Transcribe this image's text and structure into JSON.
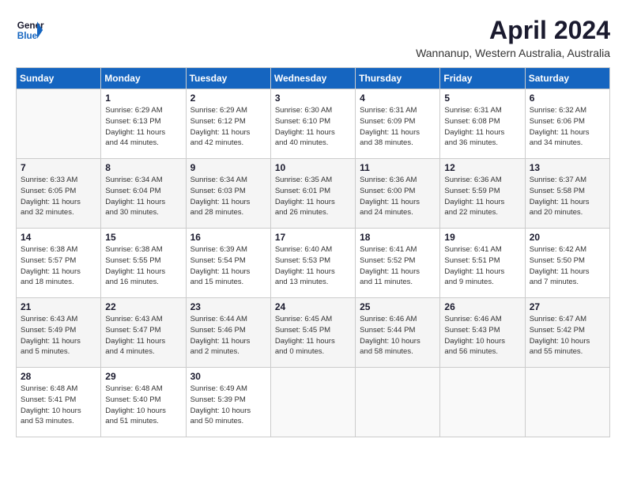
{
  "header": {
    "logo_line1": "General",
    "logo_line2": "Blue",
    "month": "April 2024",
    "location": "Wannanup, Western Australia, Australia"
  },
  "days_of_week": [
    "Sunday",
    "Monday",
    "Tuesday",
    "Wednesday",
    "Thursday",
    "Friday",
    "Saturday"
  ],
  "weeks": [
    [
      {
        "day": "",
        "info": ""
      },
      {
        "day": "1",
        "info": "Sunrise: 6:29 AM\nSunset: 6:13 PM\nDaylight: 11 hours\nand 44 minutes."
      },
      {
        "day": "2",
        "info": "Sunrise: 6:29 AM\nSunset: 6:12 PM\nDaylight: 11 hours\nand 42 minutes."
      },
      {
        "day": "3",
        "info": "Sunrise: 6:30 AM\nSunset: 6:10 PM\nDaylight: 11 hours\nand 40 minutes."
      },
      {
        "day": "4",
        "info": "Sunrise: 6:31 AM\nSunset: 6:09 PM\nDaylight: 11 hours\nand 38 minutes."
      },
      {
        "day": "5",
        "info": "Sunrise: 6:31 AM\nSunset: 6:08 PM\nDaylight: 11 hours\nand 36 minutes."
      },
      {
        "day": "6",
        "info": "Sunrise: 6:32 AM\nSunset: 6:06 PM\nDaylight: 11 hours\nand 34 minutes."
      }
    ],
    [
      {
        "day": "7",
        "info": "Sunrise: 6:33 AM\nSunset: 6:05 PM\nDaylight: 11 hours\nand 32 minutes."
      },
      {
        "day": "8",
        "info": "Sunrise: 6:34 AM\nSunset: 6:04 PM\nDaylight: 11 hours\nand 30 minutes."
      },
      {
        "day": "9",
        "info": "Sunrise: 6:34 AM\nSunset: 6:03 PM\nDaylight: 11 hours\nand 28 minutes."
      },
      {
        "day": "10",
        "info": "Sunrise: 6:35 AM\nSunset: 6:01 PM\nDaylight: 11 hours\nand 26 minutes."
      },
      {
        "day": "11",
        "info": "Sunrise: 6:36 AM\nSunset: 6:00 PM\nDaylight: 11 hours\nand 24 minutes."
      },
      {
        "day": "12",
        "info": "Sunrise: 6:36 AM\nSunset: 5:59 PM\nDaylight: 11 hours\nand 22 minutes."
      },
      {
        "day": "13",
        "info": "Sunrise: 6:37 AM\nSunset: 5:58 PM\nDaylight: 11 hours\nand 20 minutes."
      }
    ],
    [
      {
        "day": "14",
        "info": "Sunrise: 6:38 AM\nSunset: 5:57 PM\nDaylight: 11 hours\nand 18 minutes."
      },
      {
        "day": "15",
        "info": "Sunrise: 6:38 AM\nSunset: 5:55 PM\nDaylight: 11 hours\nand 16 minutes."
      },
      {
        "day": "16",
        "info": "Sunrise: 6:39 AM\nSunset: 5:54 PM\nDaylight: 11 hours\nand 15 minutes."
      },
      {
        "day": "17",
        "info": "Sunrise: 6:40 AM\nSunset: 5:53 PM\nDaylight: 11 hours\nand 13 minutes."
      },
      {
        "day": "18",
        "info": "Sunrise: 6:41 AM\nSunset: 5:52 PM\nDaylight: 11 hours\nand 11 minutes."
      },
      {
        "day": "19",
        "info": "Sunrise: 6:41 AM\nSunset: 5:51 PM\nDaylight: 11 hours\nand 9 minutes."
      },
      {
        "day": "20",
        "info": "Sunrise: 6:42 AM\nSunset: 5:50 PM\nDaylight: 11 hours\nand 7 minutes."
      }
    ],
    [
      {
        "day": "21",
        "info": "Sunrise: 6:43 AM\nSunset: 5:49 PM\nDaylight: 11 hours\nand 5 minutes."
      },
      {
        "day": "22",
        "info": "Sunrise: 6:43 AM\nSunset: 5:47 PM\nDaylight: 11 hours\nand 4 minutes."
      },
      {
        "day": "23",
        "info": "Sunrise: 6:44 AM\nSunset: 5:46 PM\nDaylight: 11 hours\nand 2 minutes."
      },
      {
        "day": "24",
        "info": "Sunrise: 6:45 AM\nSunset: 5:45 PM\nDaylight: 11 hours\nand 0 minutes."
      },
      {
        "day": "25",
        "info": "Sunrise: 6:46 AM\nSunset: 5:44 PM\nDaylight: 10 hours\nand 58 minutes."
      },
      {
        "day": "26",
        "info": "Sunrise: 6:46 AM\nSunset: 5:43 PM\nDaylight: 10 hours\nand 56 minutes."
      },
      {
        "day": "27",
        "info": "Sunrise: 6:47 AM\nSunset: 5:42 PM\nDaylight: 10 hours\nand 55 minutes."
      }
    ],
    [
      {
        "day": "28",
        "info": "Sunrise: 6:48 AM\nSunset: 5:41 PM\nDaylight: 10 hours\nand 53 minutes."
      },
      {
        "day": "29",
        "info": "Sunrise: 6:48 AM\nSunset: 5:40 PM\nDaylight: 10 hours\nand 51 minutes."
      },
      {
        "day": "30",
        "info": "Sunrise: 6:49 AM\nSunset: 5:39 PM\nDaylight: 10 hours\nand 50 minutes."
      },
      {
        "day": "",
        "info": ""
      },
      {
        "day": "",
        "info": ""
      },
      {
        "day": "",
        "info": ""
      },
      {
        "day": "",
        "info": ""
      }
    ]
  ]
}
